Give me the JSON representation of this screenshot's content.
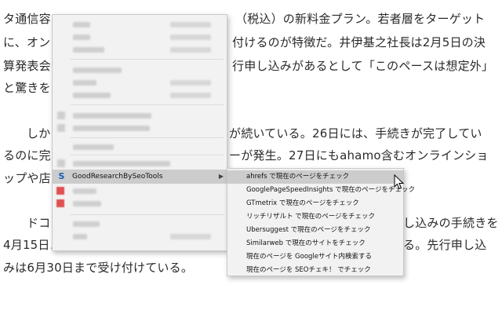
{
  "article": {
    "lines": [
      "タ通信容",
      "（税込）の新料金プラン。若者層をターゲット",
      "に、オン",
      "付けるのが特徴だ。井伊基之社長は2月5日の決",
      "算発表会",
      "行申し込みがあるとして「このペースは想定外」",
      "と驚きを",
      "しかし",
      "が続いている。26日には、手続きが完了してい",
      "るのに完",
      "ーが発生。27日にもahamo含むオンラインショ",
      "ップや店",
      "ドコモ",
      "し込みの手続きを",
      "4月15日以",
      "る。先行申し込",
      "みは6月30日まで受け付けている。"
    ]
  },
  "context_menu": {
    "extension_item": {
      "icon": "S",
      "label": "GoodResearchBySeoTools",
      "arrow": "▶"
    }
  },
  "submenu": {
    "items": [
      "ahrefs で現在のページをチェック",
      "GooglePageSpeedInsights で現在のページをチェック",
      "GTmetrix で現在のページをチェック",
      "リッチリザルト で現在のページをチェック",
      "Ubersuggest で現在のページをチェック",
      "Similarweb で現在のサイトをチェック",
      "現在のページを Googleサイト内検索する",
      "現在のページを SEOチェキ！ でチェック"
    ]
  }
}
